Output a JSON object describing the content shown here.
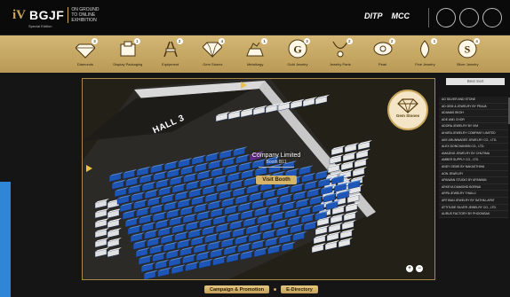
{
  "header": {
    "logo_mark": "iV",
    "brand": "BGJF",
    "brand_sub": [
      "ON GROUND",
      "TO ONLINE",
      "EXHIBITION"
    ],
    "special": "Special Edition",
    "partners": [
      "DITP",
      "MCC"
    ]
  },
  "categories": [
    {
      "label": "Diamonds",
      "count": "3",
      "icon": "diamond-icon"
    },
    {
      "label": "Display Packaging",
      "count": "1",
      "icon": "display-box-icon"
    },
    {
      "label": "Equipment",
      "count": "2",
      "icon": "equipment-icon"
    },
    {
      "label": "Gem Stones",
      "count": "4",
      "icon": "gemstone-icon"
    },
    {
      "label": "Metallurgy",
      "count": "1",
      "icon": "metallurgy-icon"
    },
    {
      "label": "Gold Jewelry",
      "count": "3",
      "icon": "gold-letter-icon"
    },
    {
      "label": "Jewelry Parts",
      "count": "2",
      "icon": "necklace-icon"
    },
    {
      "label": "Pearl",
      "count": "2",
      "icon": "pearl-icon"
    },
    {
      "label": "Fine Jewelry",
      "count": "1",
      "icon": "gem-drop-icon"
    },
    {
      "label": "Silver Jewelry",
      "count": "4",
      "icon": "silver-s-icon"
    }
  ],
  "hall": {
    "title": "HALL 3"
  },
  "selected_category": {
    "label": "Gem Stones"
  },
  "booth_popup": {
    "company": "Company Limited",
    "booth": "Booth B11",
    "visit_label": "Visit Booth"
  },
  "exhibitors": {
    "best_label": "Best Sort",
    "items": [
      "AG SILVER AND STONE",
      "AD GEM & JEWELRY BY PRAJA",
      "ADAMAS BKOH",
      "ADE AND CHOR",
      "ADORA JEWELRY BY VIM",
      "AHURA JEWELRY COMPANY LIMITED",
      "AKE ARUNWADEE JEWELRY CO., LTD.",
      "ALEX DONCHANSIN CO., LTD.",
      "AMAZING JEWELRY BY CHUTIMA",
      "AMBER SUPPLY CO., LTD.",
      "ANDY GEMS BY NAKASTHIHA",
      "AON JEWELRY",
      "APAIWAN STUDIO BY APAIWAN",
      "ARKEYA DIAMOND BORNAI",
      "ARPA JEWELRY THAILU",
      "ARTISAN JEWELRY BY SATHILLAPAT",
      "ATTITUDE SILVER JEWELRY CO., LTD.",
      "AURUS FACTORY BY PHOONSAK"
    ]
  },
  "zoom": {
    "in": "+",
    "out": "−"
  },
  "bottom_nav": {
    "campaign": "Campaign & Promotion",
    "directory": "E-Directory"
  },
  "colors": {
    "gold": "#c9a75a",
    "booth_blue": "#1e56b8",
    "booth_white": "#e6e6e6",
    "highlight": "#6a2a8a",
    "accent_blue": "#2f86d6"
  }
}
